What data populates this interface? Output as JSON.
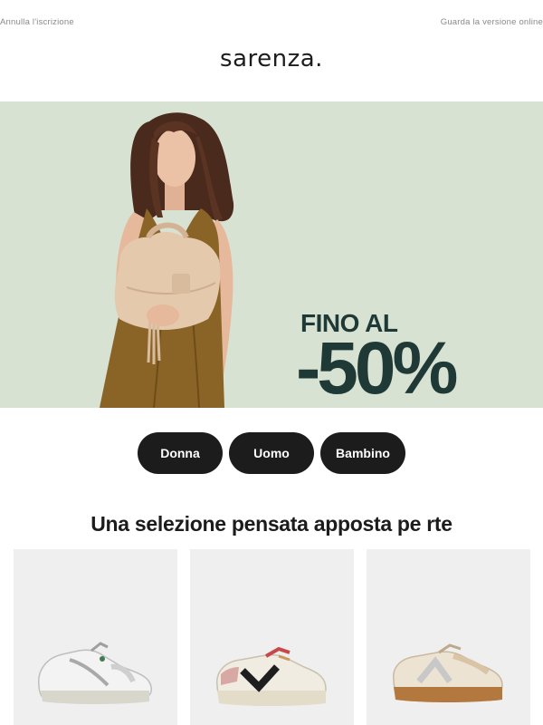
{
  "header": {
    "unsubscribe_label": "Annulla l'iscrizione",
    "view_online_label": "Guarda la versione online",
    "logo_text": "sarenza."
  },
  "hero": {
    "line1": "FINO AL",
    "line2": "-50%",
    "background_color": "#d8e2d3",
    "text_color": "#1f3a36"
  },
  "categories": [
    {
      "label": "Donna"
    },
    {
      "label": "Uomo"
    },
    {
      "label": "Bambino"
    }
  ],
  "section": {
    "title": "Una selezione pensata apposta pe rte"
  },
  "products": [
    {
      "icon": "white-silver-sneaker-icon"
    },
    {
      "icon": "cream-black-sneaker-icon"
    },
    {
      "icon": "beige-silver-sneaker-icon"
    }
  ]
}
